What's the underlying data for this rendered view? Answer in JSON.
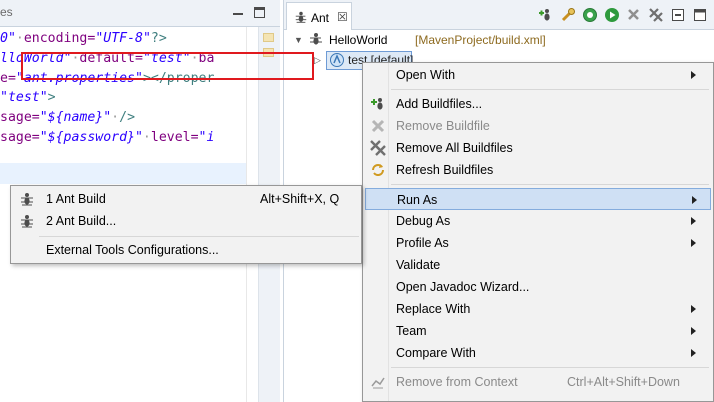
{
  "editor": {
    "tab_text": "es",
    "code_lines": [
      [
        {
          "t": "0\"",
          "c": "str"
        },
        {
          "t": "·",
          "c": "dot"
        },
        {
          "t": "encoding=",
          "c": "attr"
        },
        {
          "t": "\"UTF-8\"",
          "c": "str"
        },
        {
          "t": "?>",
          "c": "tag"
        }
      ],
      [
        {
          "t": "lloWorld\"",
          "c": "str"
        },
        {
          "t": "·",
          "c": "dot"
        },
        {
          "t": "default=",
          "c": "attr"
        },
        {
          "t": "\"test\"",
          "c": "str"
        },
        {
          "t": "·",
          "c": "dot"
        },
        {
          "t": "ba",
          "c": "attr"
        }
      ],
      [
        {
          "t": "e=",
          "c": "attr"
        },
        {
          "t": "\"ant.properties\"",
          "c": "str"
        },
        {
          "t": "></proper",
          "c": "tag"
        }
      ],
      [
        {
          "t": "\"test\"",
          "c": "str"
        },
        {
          "t": ">",
          "c": "tag"
        }
      ],
      [
        {
          "t": "sage=",
          "c": "attr"
        },
        {
          "t": "\"${name}\"",
          "c": "str"
        },
        {
          "t": "·",
          "c": "dot"
        },
        {
          "t": "/>",
          "c": "tag"
        }
      ],
      [
        {
          "t": "sage=",
          "c": "attr"
        },
        {
          "t": "\"${password}\"",
          "c": "str"
        },
        {
          "t": "·",
          "c": "dot"
        },
        {
          "t": "level=",
          "c": "attr"
        },
        {
          "t": "\"i",
          "c": "str"
        }
      ]
    ]
  },
  "ant_view": {
    "tab_label": "Ant",
    "tab_close": "☒",
    "tree": {
      "project_label": "HelloWorld",
      "project_path": "[MavenProject/build.xml]",
      "target_label": "test [default]"
    }
  },
  "context_menu": {
    "items": [
      {
        "label": "Open With",
        "submenu": true,
        "icon": "",
        "disabled": false,
        "shortcut": ""
      },
      {
        "sep": true
      },
      {
        "label": "Add Buildfiles...",
        "icon": "add-buildfile-icon",
        "disabled": false,
        "submenu": false,
        "shortcut": ""
      },
      {
        "label": "Remove Buildfile",
        "icon": "remove-buildfile-icon",
        "disabled": true,
        "submenu": false,
        "shortcut": ""
      },
      {
        "label": "Remove All Buildfiles",
        "icon": "remove-all-buildfiles-icon",
        "disabled": false,
        "submenu": false,
        "shortcut": ""
      },
      {
        "label": "Refresh Buildfiles",
        "icon": "refresh-buildfiles-icon",
        "disabled": false,
        "submenu": false,
        "shortcut": ""
      },
      {
        "sep": true
      },
      {
        "label": "Run As",
        "submenu": true,
        "highlight": true,
        "icon": "",
        "disabled": false,
        "shortcut": ""
      },
      {
        "label": "Debug As",
        "submenu": true,
        "icon": "",
        "disabled": false,
        "shortcut": ""
      },
      {
        "label": "Profile As",
        "submenu": true,
        "icon": "",
        "disabled": false,
        "shortcut": ""
      },
      {
        "label": "Validate",
        "submenu": false,
        "icon": "",
        "disabled": false,
        "shortcut": ""
      },
      {
        "label": "Open Javadoc Wizard...",
        "submenu": false,
        "icon": "",
        "disabled": false,
        "shortcut": ""
      },
      {
        "label": "Replace With",
        "submenu": true,
        "icon": "",
        "disabled": false,
        "shortcut": ""
      },
      {
        "label": "Team",
        "submenu": true,
        "icon": "",
        "disabled": false,
        "shortcut": ""
      },
      {
        "label": "Compare With",
        "submenu": true,
        "icon": "",
        "disabled": false,
        "shortcut": ""
      },
      {
        "sep": true
      },
      {
        "label": "Remove from Context",
        "icon": "remove-from-context-icon",
        "disabled": true,
        "submenu": false,
        "shortcut": "Ctrl+Alt+Shift+Down"
      }
    ]
  },
  "run_as_submenu": {
    "items": [
      {
        "label": "1 Ant Build",
        "shortcut": "Alt+Shift+X, Q",
        "icon": "ant-icon"
      },
      {
        "label": "2 Ant Build...",
        "shortcut": "",
        "icon": "ant-icon"
      },
      {
        "label": "External Tools Configurations...",
        "shortcut": "",
        "icon": ""
      }
    ]
  },
  "colors": {
    "highlight_box": "#e0191e",
    "menu_highlight": "#cfe0f4",
    "project_path": "#8d6a1f"
  }
}
